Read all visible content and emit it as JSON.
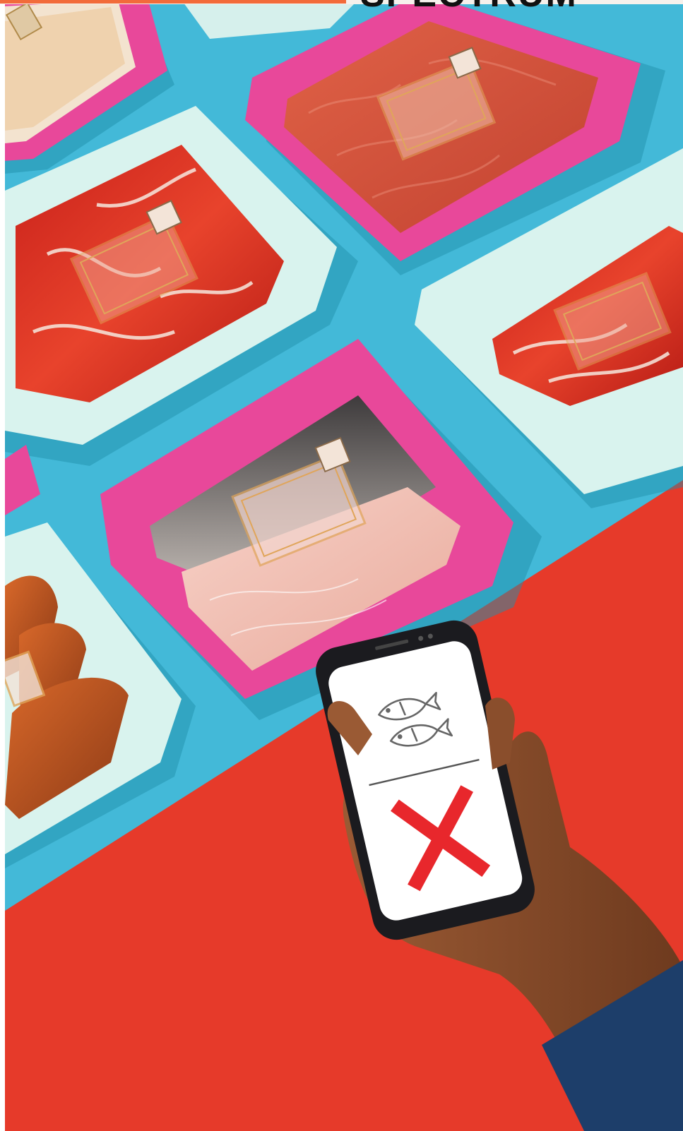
{
  "masthead": {
    "title": "SPECTRUM"
  },
  "scene": {
    "subject": "rfid-tagged-meat-trays-and-phone",
    "colors": {
      "background_blue": "#43b9d8",
      "background_red": "#e63a2a",
      "tray_pink": "#e8489a",
      "tray_white": "#d9f3ee",
      "header_orange": "#f26b3a"
    },
    "phone_screen": {
      "top_icon": "fish-icon",
      "bottom_icon": "x-mark-icon",
      "x_color": "#e8272c"
    }
  }
}
